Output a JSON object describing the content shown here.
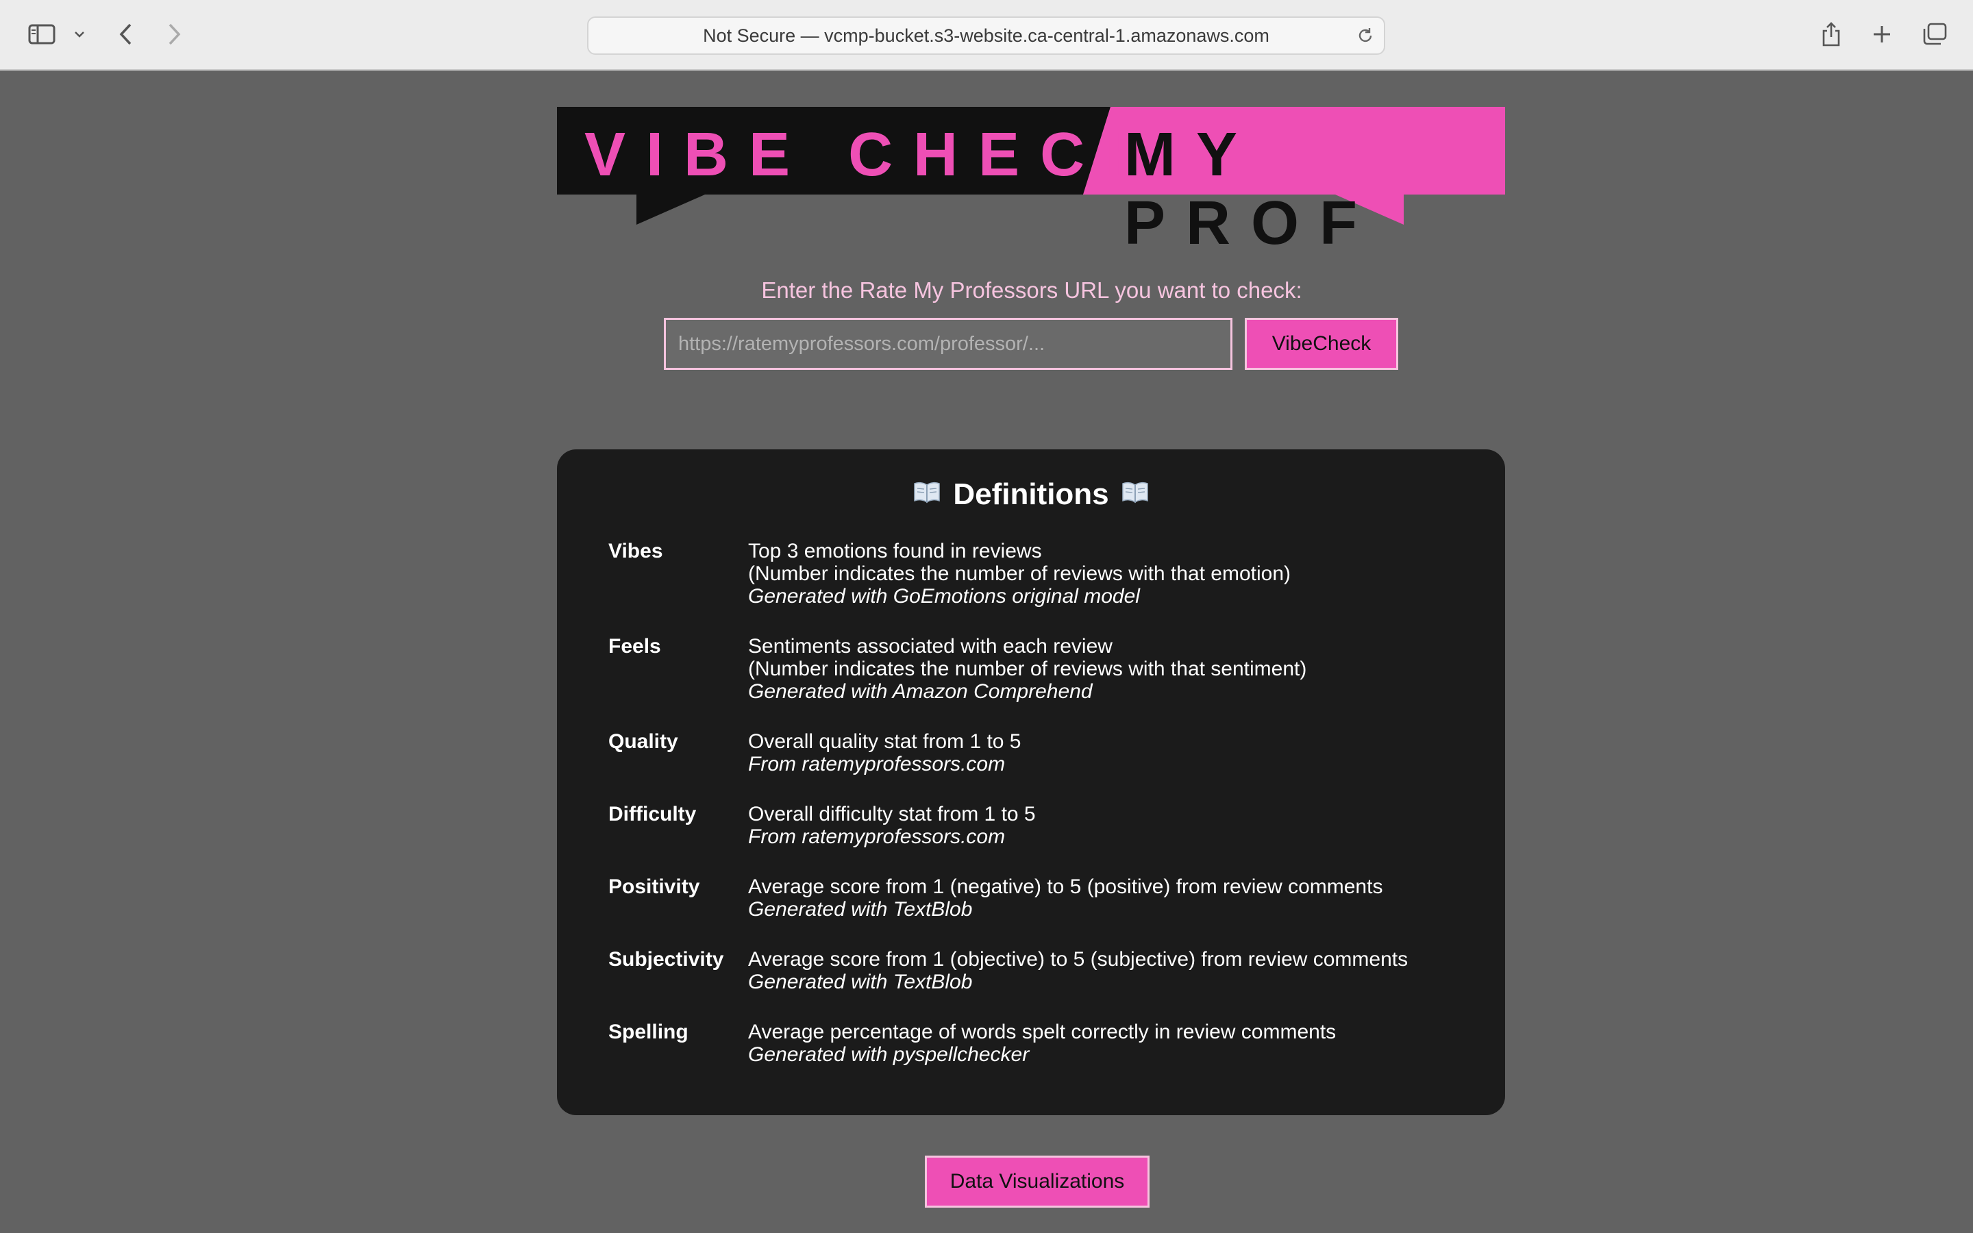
{
  "browser": {
    "address": "Not Secure — vcmp-bucket.s3-website.ca-central-1.amazonaws.com",
    "icons": [
      "sidebar-icon",
      "chevron-down-icon",
      "back-icon",
      "forward-icon",
      "reload-icon",
      "share-icon",
      "new-tab-icon",
      "tab-overview-icon"
    ]
  },
  "logo": {
    "left_text": "VIBE CHECK",
    "right_text": "MY PROF",
    "colors": {
      "pink": "#ee4fb5",
      "black": "#111111"
    }
  },
  "form": {
    "prompt": "Enter the Rate My Professors URL you want to check:",
    "placeholder": "https://ratemyprofessors.com/professor/...",
    "value": "",
    "submit_label": "VibeCheck"
  },
  "definitions": {
    "title": "Definitions",
    "icon": "open-book-icon",
    "items": [
      {
        "term": "Vibes",
        "lines": [
          "Top 3 emotions found in reviews",
          "(Number indicates the number of reviews with that emotion)"
        ],
        "source": "Generated with GoEmotions original model"
      },
      {
        "term": "Feels",
        "lines": [
          "Sentiments associated with each review",
          "(Number indicates the number of reviews with that sentiment)"
        ],
        "source": "Generated with Amazon Comprehend"
      },
      {
        "term": "Quality",
        "lines": [
          "Overall quality stat from 1 to 5"
        ],
        "source": "From ratemyprofessors.com"
      },
      {
        "term": "Difficulty",
        "lines": [
          "Overall difficulty stat from 1 to 5"
        ],
        "source": "From ratemyprofessors.com"
      },
      {
        "term": "Positivity",
        "lines": [
          "Average score from 1 (negative) to 5 (positive) from review comments"
        ],
        "source": "Generated with TextBlob"
      },
      {
        "term": "Subjectivity",
        "lines": [
          "Average score from 1 (objective) to 5 (subjective) from review comments"
        ],
        "source": "Generated with TextBlob"
      },
      {
        "term": "Spelling",
        "lines": [
          "Average percentage of words spelt correctly in review comments"
        ],
        "source": "Generated with pyspellchecker"
      }
    ]
  },
  "footer": {
    "dataviz_label": "Data Visualizations"
  },
  "colors": {
    "page_bg": "#626262",
    "card_bg": "#1b1b1b",
    "accent": "#ee4fb5",
    "accent_light": "#f6c4df"
  }
}
